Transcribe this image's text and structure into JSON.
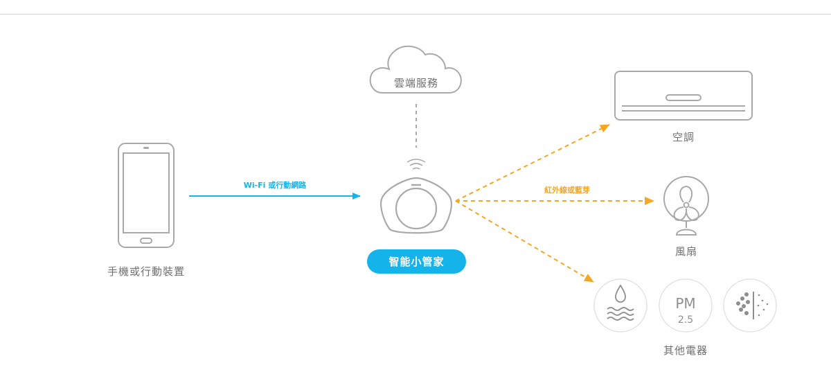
{
  "nodes": {
    "mobile": {
      "label": "手機或行動裝置"
    },
    "cloud": {
      "label": "雲端服務"
    },
    "hub": {
      "label": "智能小管家"
    },
    "air_conditioner": {
      "label": "空調"
    },
    "fan": {
      "label": "風扇"
    },
    "other_appliances": {
      "label": "其他電器",
      "icons": [
        "water-icon",
        "pm25-icon",
        "particles-icon"
      ],
      "pm_text": "PM",
      "pm_value": "2.5"
    }
  },
  "links": {
    "mobile_to_hub": {
      "label": "Wi-Fi 或行動網路"
    },
    "hub_to_devices": {
      "label": "紅外線或藍芽"
    }
  },
  "colors": {
    "wifi_link": "#14b4ea",
    "ir_link": "#f5a623",
    "outline": "#a9a9a9",
    "hub_badge": "#14b4ea",
    "text": "#6f6f6f"
  }
}
